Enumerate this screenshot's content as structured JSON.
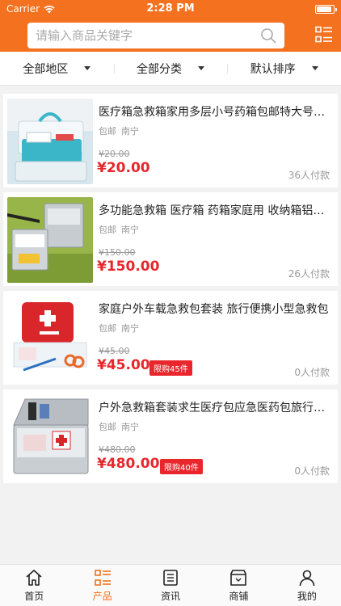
{
  "status": {
    "carrier": "Carrier",
    "time": "2:28 PM",
    "battery_level": 0.9
  },
  "search": {
    "placeholder": "请输入商品关键字"
  },
  "filters": [
    {
      "label": "全部地区"
    },
    {
      "label": "全部分类"
    },
    {
      "label": "默认排序"
    }
  ],
  "products": [
    {
      "title": "医疗箱急救箱家用多层小号药箱包邮特大号带锁",
      "shipping": "包邮",
      "city": "南宁",
      "old_price": "¥20.00",
      "price": "¥20.00",
      "limit": "",
      "sold": "36人付款"
    },
    {
      "title": "多功能急救箱 医疗箱 药箱家庭用 收纳箱铝合金",
      "shipping": "包邮",
      "city": "南宁",
      "old_price": "¥150.00",
      "price": "¥150.00",
      "limit": "",
      "sold": "26人付款"
    },
    {
      "title": "家庭户外车载急救包套装 旅行便携小型急救包",
      "shipping": "包邮",
      "city": "南宁",
      "old_price": "¥45.00",
      "price": "¥45.00",
      "limit": "限购45件",
      "sold": "0人付款"
    },
    {
      "title": "户外急救箱套装求生医疗包应急医药包旅行必备",
      "shipping": "包邮",
      "city": "南宁",
      "old_price": "¥480.00",
      "price": "¥480.00",
      "limit": "限购40件",
      "sold": "0人付款"
    }
  ],
  "tabs": [
    {
      "label": "首页",
      "icon": "home-icon"
    },
    {
      "label": "产品",
      "icon": "list-icon",
      "active": true
    },
    {
      "label": "资讯",
      "icon": "news-icon"
    },
    {
      "label": "商铺",
      "icon": "store-icon"
    },
    {
      "label": "我的",
      "icon": "user-icon"
    }
  ],
  "colors": {
    "accent": "#f3711f",
    "price": "#e8262c"
  }
}
